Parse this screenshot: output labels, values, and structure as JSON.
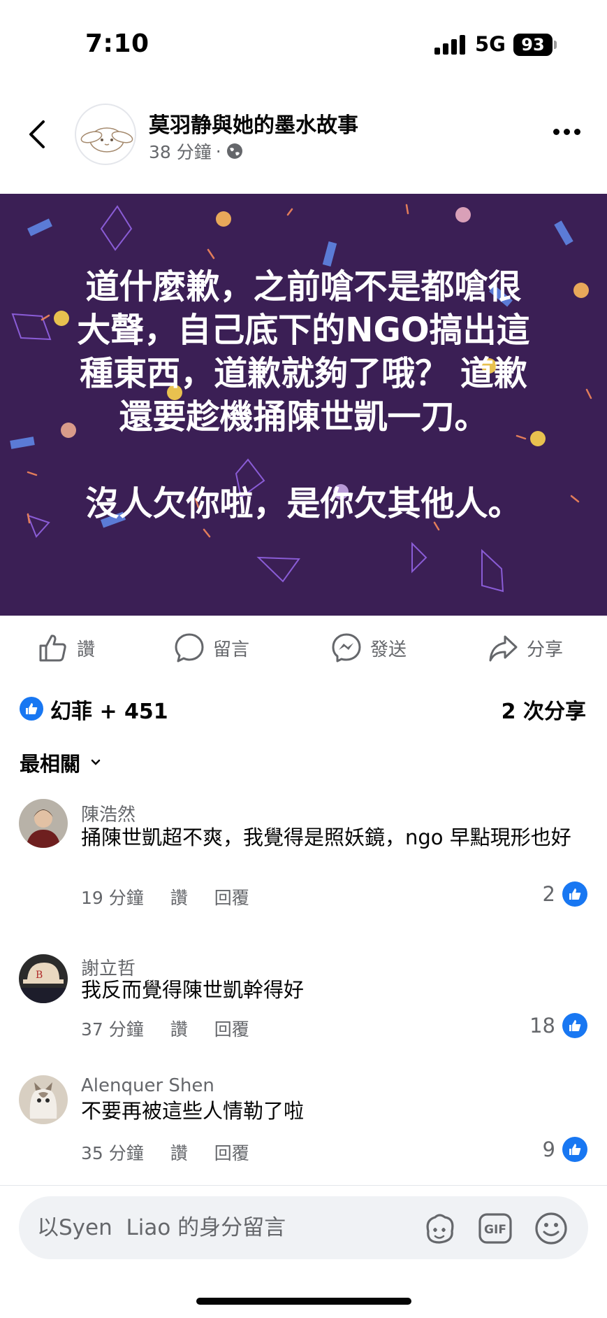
{
  "status_bar": {
    "time": "7:10",
    "network": "5G",
    "battery": "93"
  },
  "post": {
    "page_name": "莫羽静與她的墨水故事",
    "time": "38 分鐘",
    "separator": "·",
    "privacy_icon": "globe-icon",
    "image_text": "道什麼歉，之前嗆不是都嗆很\n大聲，自己底下的NGO搞出這\n種東西，道歉就夠了哦？ 道歉\n還要趁機捅陳世凱一刀。\n\n沒人欠你啦，是你欠其他人。",
    "image_bg": "#3b1f55"
  },
  "actions": {
    "like": "讚",
    "comment": "留言",
    "send": "發送",
    "share": "分享"
  },
  "reactions": {
    "summary": "幻菲 + 451",
    "shares": "2 次分享"
  },
  "sort": {
    "label": "最相關"
  },
  "comments": [
    {
      "name": "陳浩然",
      "text": "捅陳世凱超不爽，我覺得是照妖鏡，ngo 早點現形也好",
      "time": "19 分鐘",
      "like": "讚",
      "reply": "回覆",
      "likes": "2"
    },
    {
      "name": "謝立哲",
      "text": "我反而覺得陳世凱幹得好",
      "time": "37 分鐘",
      "like": "讚",
      "reply": "回覆",
      "likes": "18"
    },
    {
      "name": "Alenquer Shen",
      "text": "不要再被這些人情勒了啦",
      "time": "35 分鐘",
      "like": "讚",
      "reply": "回覆",
      "likes": "9"
    }
  ],
  "composer": {
    "placeholder": "以Syen  Liao 的身分留言",
    "gif_label": "GIF"
  },
  "colors": {
    "accent": "#1877f2",
    "secondary_text": "#65676b"
  }
}
